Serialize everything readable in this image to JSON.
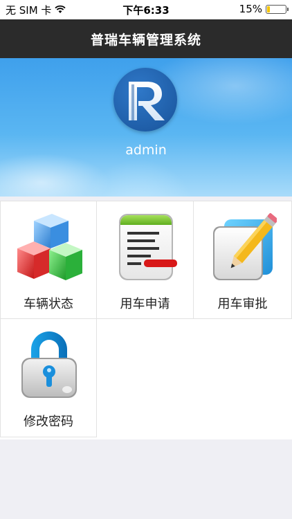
{
  "status_bar": {
    "carrier": "无 SIM 卡",
    "time": "下午6:33",
    "battery_percent_text": "15%",
    "battery_level": 0.15,
    "wifi_icon": "wifi-icon",
    "battery_icon": "battery-icon"
  },
  "header": {
    "title": "普瑞车辆管理系统"
  },
  "profile": {
    "logo_icon": "r-logo-icon",
    "username": "admin"
  },
  "menu": [
    {
      "label": "车辆状态",
      "icon": "cubes-icon"
    },
    {
      "label": "用车申请",
      "icon": "document-icon"
    },
    {
      "label": "用车审批",
      "icon": "pencil-notebook-icon"
    },
    {
      "label": "修改密码",
      "icon": "padlock-icon"
    }
  ],
  "colors": {
    "title_bar": "#2b2b2b",
    "banner_blue": "#3fa0ec",
    "battery_fill": "#f5c400"
  }
}
